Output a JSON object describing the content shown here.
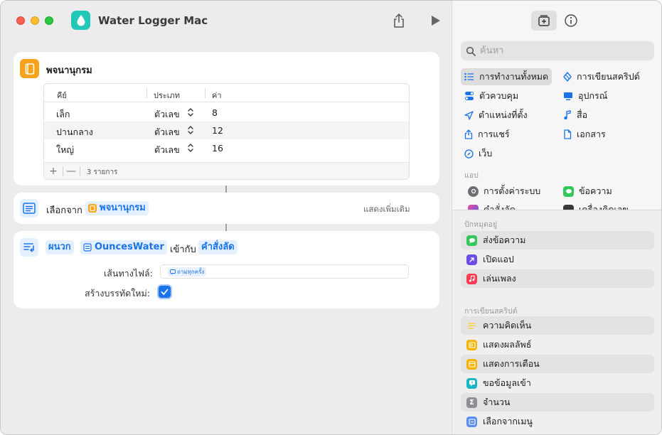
{
  "window": {
    "title": "Water Logger Mac"
  },
  "action_dictionary": {
    "title": "พจนานุกรม",
    "columns": [
      "คีย์",
      "ประเภท",
      "ค่า"
    ],
    "rows": [
      {
        "key": "เล็ก",
        "type": "ตัวเลข",
        "value": "8"
      },
      {
        "key": "ปานกลาง",
        "type": "ตัวเลข",
        "value": "12"
      },
      {
        "key": "ใหญ่",
        "type": "ตัวเลข",
        "value": "16"
      }
    ],
    "add_label": "+",
    "remove_label": "—",
    "count_label": "3 รายการ"
  },
  "action_choose": {
    "prefix": "เลือกจาก",
    "variable": "พจนานุกรม",
    "more_label": "แสดงเพิ่มเติม"
  },
  "action_append": {
    "prefix": "ผนวก",
    "variable": "OuncesWater",
    "connector": "เข้ากับ",
    "target": "คำสั่งลัด",
    "file_path_label": "เส้นทางไฟล์:",
    "file_path_token": "ถามทุกครั้ง",
    "new_line_label": "สร้างบรรทัดใหม่:",
    "new_line_checked": true
  },
  "sidebar": {
    "search_placeholder": "ค้นหา",
    "categories": [
      {
        "label": "การทำงานทั้งหมด",
        "icon": "list-icon",
        "selected": true
      },
      {
        "label": "การเขียนสคริปต์",
        "icon": "script-icon"
      },
      {
        "label": "ตัวควบคุม",
        "icon": "toggle-icon"
      },
      {
        "label": "อุปกรณ์",
        "icon": "display-icon"
      },
      {
        "label": "ตำแหน่งที่ตั้ง",
        "icon": "location-arrow-icon"
      },
      {
        "label": "สื่อ",
        "icon": "music-note-icon"
      },
      {
        "label": "การแชร์",
        "icon": "share-icon"
      },
      {
        "label": "เอกสาร",
        "icon": "document-icon"
      },
      {
        "label": "เว็บ",
        "icon": "compass-icon"
      }
    ],
    "apps_section": "แอป",
    "apps": [
      {
        "label": "การตั้งค่าระบบ",
        "icon": "settings-gear-icon"
      },
      {
        "label": "ข้อความ",
        "icon": "messages-icon"
      },
      {
        "label": "คำสั่งลัด",
        "icon": "shortcuts-icon"
      },
      {
        "label": "เครื่องคิดเลข",
        "icon": "calculator-icon"
      }
    ],
    "pinned_section": "ปักหมุดอยู่",
    "pinned": [
      {
        "label": "ส่งข้อความ",
        "icon": "message-bubble-icon",
        "color": "#34c759"
      },
      {
        "label": "เปิดแอป",
        "icon": "open-app-arrow-icon",
        "color": "#6e4de6"
      },
      {
        "label": "เล่นเพลง",
        "icon": "music-icon",
        "color": "#fa3c55"
      }
    ],
    "scripting_section": "การเขียนสคริปต์",
    "scripting": [
      {
        "label": "ความคิดเห็น",
        "icon": "comment-lines-icon",
        "color": "#f5d547"
      },
      {
        "label": "แสดงผลลัพธ์",
        "icon": "show-result-icon",
        "color": "#f5b400"
      },
      {
        "label": "แสดงการเตือน",
        "icon": "alert-icon",
        "color": "#f5b400"
      },
      {
        "label": "ขอข้อมูลเข้า",
        "icon": "ask-input-icon",
        "color": "#1ab5c4"
      },
      {
        "label": "จำนวน",
        "icon": "sigma-icon",
        "color": "#8e8e93"
      },
      {
        "label": "เลือกจากเมนู",
        "icon": "menu-icon",
        "color": "#5b8def"
      }
    ]
  }
}
